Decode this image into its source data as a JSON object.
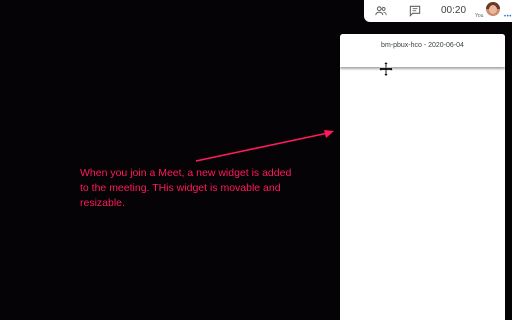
{
  "topbar": {
    "icons": [
      "people-icon",
      "chat-icon"
    ],
    "time": "00:20",
    "you_label": "You",
    "more_label": "•••"
  },
  "widget": {
    "title": "bm-pbux-hco - 2020-06-04",
    "cursor_icon": "move-icon"
  },
  "annotation": {
    "text": "When you join a Meet, a new widget is added to the meeting. THis widget is movable and resizable.",
    "color": "#ff1a5e"
  }
}
